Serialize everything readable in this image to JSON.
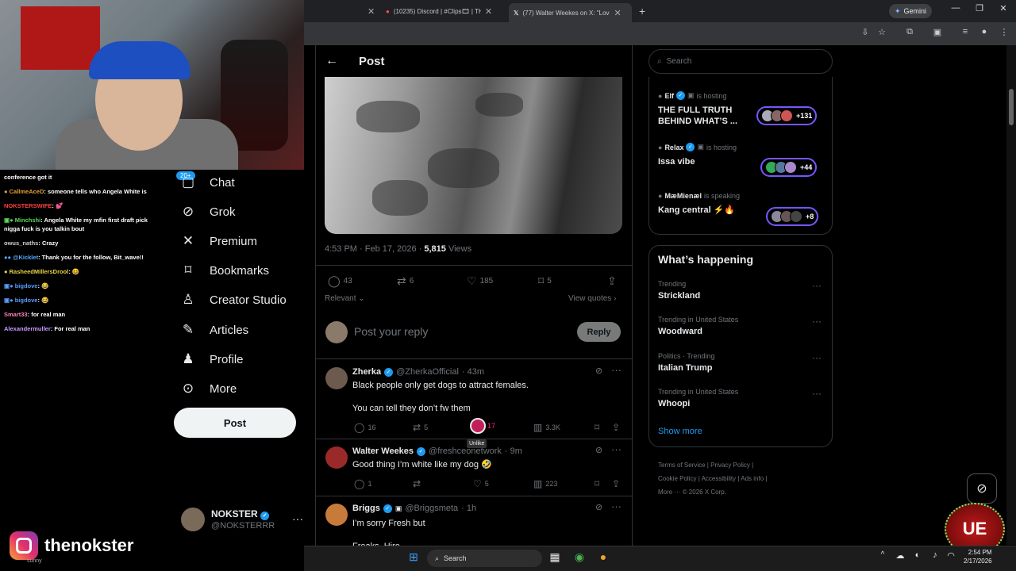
{
  "browser": {
    "tabs": [
      {
        "label": "(10235) Discord | #Clips🎞 | TH",
        "icon": "discord-icon"
      },
      {
        "label": "(77) Walter Weekes on X: \"Love",
        "icon": "x-logo-icon"
      }
    ],
    "gemini_label": "Gemini"
  },
  "stream": {
    "chat": [
      {
        "user": "",
        "text": "conference got it",
        "color": "#ffffff"
      },
      {
        "user": "CallmeAceD",
        "text": "someone tells who Angela White is",
        "color": "#e6a235"
      },
      {
        "user": "NOKSTERSWIFE",
        "text": "💕",
        "color": "#ff4040"
      },
      {
        "user": "Minchshi",
        "text": "Angela White my mfin first draft pick nigga fuck is you talkin bout",
        "color": "#5cd65c"
      },
      {
        "user": "owus_naths",
        "text": "Crazy",
        "color": "#cccccc"
      },
      {
        "user": "@Kicklet",
        "text": "Thank you for the follow, Bit_wave!!",
        "color": "#53a7ff"
      },
      {
        "user": "RasheedMillersDrool",
        "text": "😆",
        "color": "#e8d34a"
      },
      {
        "user": "bigdove",
        "text": "😂",
        "color": "#5a9cff"
      },
      {
        "user": "bigdove",
        "text": "😂",
        "color": "#5a9cff"
      },
      {
        "user": "Smart33",
        "text": "for real man",
        "color": "#ff7fbf"
      },
      {
        "user": "Alexandermuller",
        "text": "For real man",
        "color": "#c99bff"
      }
    ],
    "brand": "thenokster",
    "sunny": "sunny"
  },
  "nav": {
    "badge": "20+",
    "items": [
      {
        "label": "Chat",
        "icon": "chat-icon"
      },
      {
        "label": "Grok",
        "icon": "grok-icon"
      },
      {
        "label": "Premium",
        "icon": "x-premium-icon"
      },
      {
        "label": "Bookmarks",
        "icon": "bookmark-icon"
      },
      {
        "label": "Creator Studio",
        "icon": "creator-studio-icon"
      },
      {
        "label": "Articles",
        "icon": "articles-icon"
      },
      {
        "label": "Profile",
        "icon": "profile-icon"
      },
      {
        "label": "More",
        "icon": "more-icon"
      }
    ],
    "post_button": "Post",
    "account": {
      "name": "NOKSTER",
      "handle": "@NOKSTERRR"
    }
  },
  "main": {
    "title": "Post",
    "meta": {
      "time": "4:53 PM · Feb 17, 2026 · ",
      "views": "5,815",
      "views_label": " Views"
    },
    "actions": {
      "replies": "43",
      "reposts": "6",
      "likes": "185",
      "bookmarks": "5"
    },
    "relevant": "Relevant",
    "view_quotes": "View quotes",
    "reply_placeholder": "Post your reply",
    "reply_button": "Reply",
    "replies": [
      {
        "name": "Zherka",
        "handle": "@ZherkaOfficial",
        "time": "· 43m",
        "line1": "Black people only get dogs to attract females.",
        "line2": "You can tell they don’t fw them",
        "replies": "16",
        "reposts": "5",
        "likes": "17",
        "views": "3.3K"
      },
      {
        "name": "Walter Weekes",
        "handle": "@freshceonetwork",
        "time": "· 9m",
        "line1": "Good thing I’m white like my dog 🤣",
        "replies": "1",
        "reposts": "",
        "likes": "5",
        "views": "223"
      },
      {
        "name": "Briggs",
        "handle": "@Briggsmeta",
        "time": "· 1h",
        "line1": "I’m sorry Fresh but",
        "line2": "Freaks. Hire"
      }
    ],
    "tooltip": "Unlike"
  },
  "right": {
    "search_placeholder": "Search",
    "spaces": [
      {
        "host": "Elf",
        "status": "is hosting",
        "title": "THE FULL TRUTH BEHIND WHAT’S ...",
        "count": "+131"
      },
      {
        "host": "Relax",
        "status": "is hosting",
        "title": "Issa vibe",
        "count": "+44"
      },
      {
        "host": "MæMienæl",
        "status": "is speaking",
        "title": "Kang central ⚡🔥",
        "count": "+8"
      }
    ],
    "happening_title": "What’s happening",
    "trends": [
      {
        "context": "Trending",
        "name": "Strickland"
      },
      {
        "context": "Trending in United States",
        "name": "Woodward"
      },
      {
        "context": "Politics · Trending",
        "name": "Italian Trump"
      },
      {
        "context": "Trending in United States",
        "name": "Whoopi"
      }
    ],
    "show_more": "Show more",
    "footer": [
      "Terms of Service",
      "Privacy Policy",
      "Cookie Policy",
      "Accessibility",
      "Ads info",
      "More ···",
      "© 2026 X Corp."
    ]
  },
  "taskbar": {
    "search": "Search",
    "time": "2:54 PM",
    "date": "2/17/2026"
  },
  "colors": {
    "accent": "#1d9bf0",
    "like": "#f91880",
    "space_ring": "#7856ff"
  }
}
